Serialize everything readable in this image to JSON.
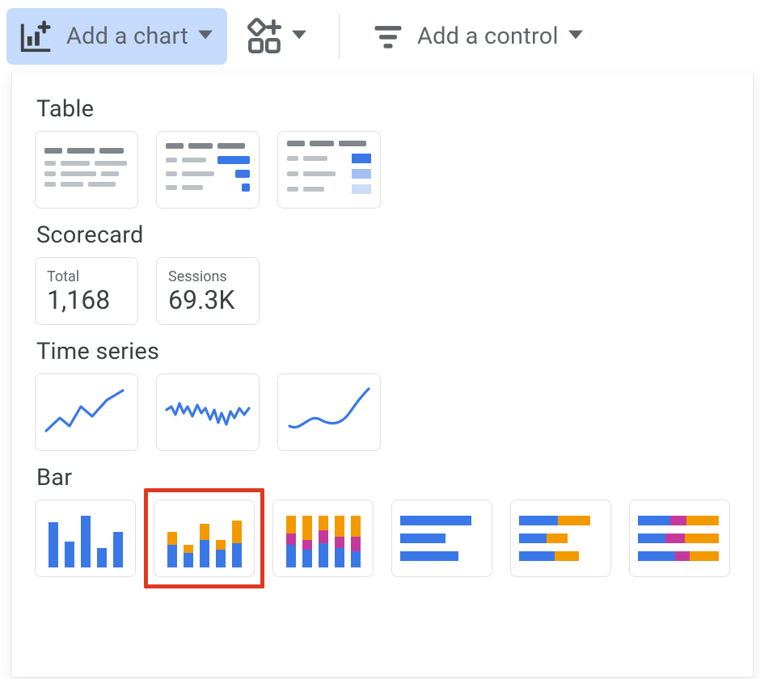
{
  "toolbar": {
    "add_chart_label": "Add a chart",
    "add_control_label": "Add a control"
  },
  "sections": {
    "table": "Table",
    "scorecard": "Scorecard",
    "timeseries": "Time series",
    "bar": "Bar"
  },
  "scorecards": [
    {
      "label": "Total",
      "value": "1,168"
    },
    {
      "label": "Sessions",
      "value": "69.3K"
    }
  ],
  "highlighted_bar_index": 1
}
